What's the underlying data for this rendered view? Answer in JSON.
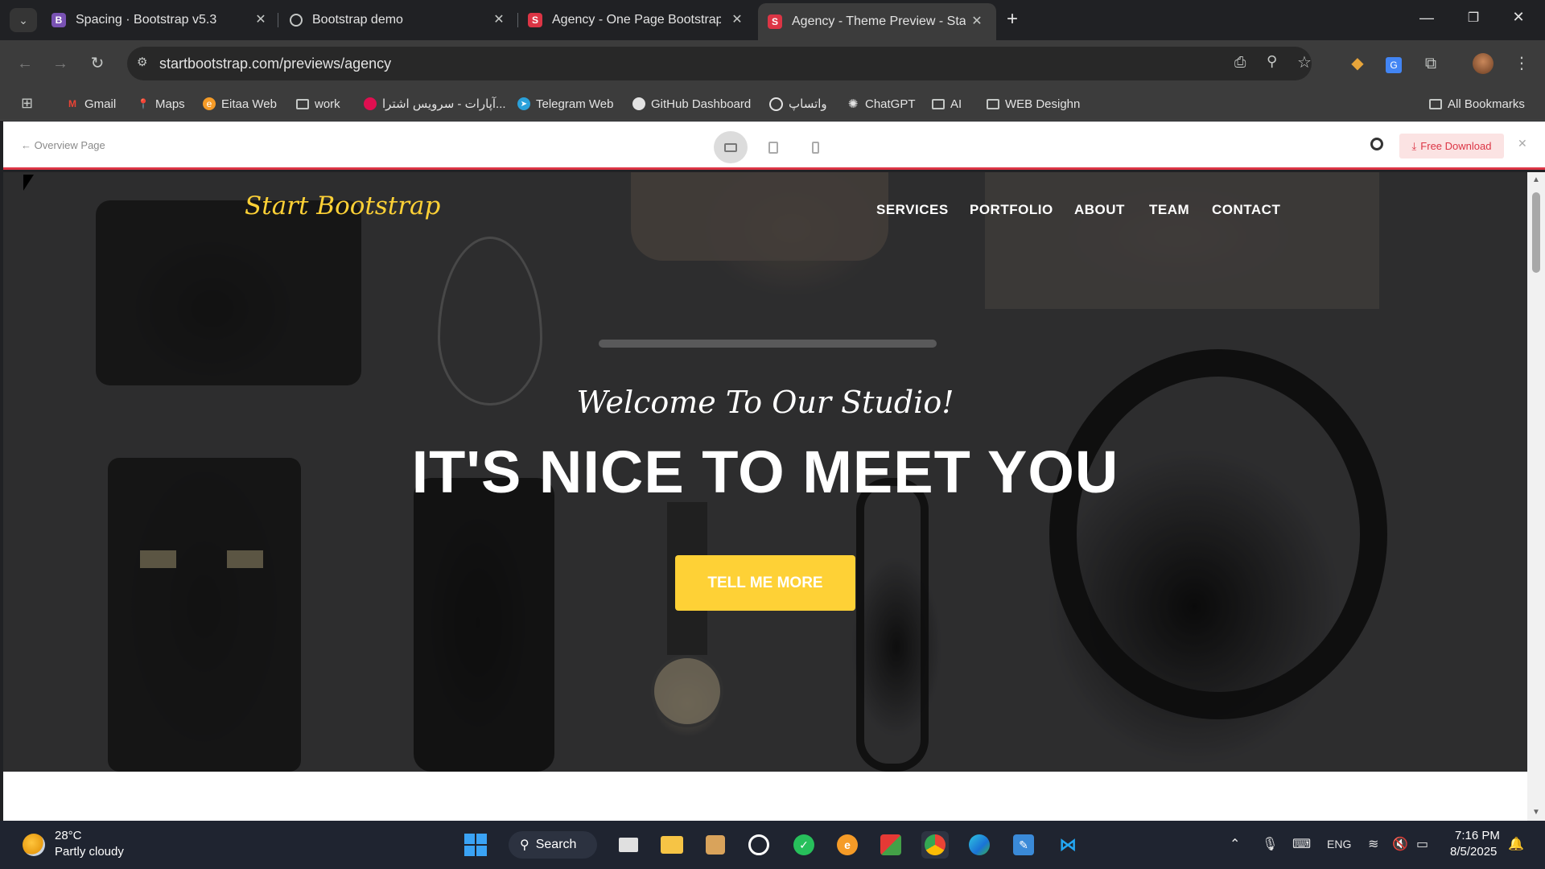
{
  "browser": {
    "tabs": [
      {
        "title": "Spacing · Bootstrap v5.3",
        "favicon": "B",
        "favicon_color": "#7952b3",
        "active": false
      },
      {
        "title": "Bootstrap demo",
        "favicon": "globe-icon",
        "active": false
      },
      {
        "title": "Agency - One Page Bootstrap T",
        "favicon": "S",
        "favicon_color": "#dc3545",
        "active": false
      },
      {
        "title": "Agency - Theme Preview - Star",
        "favicon": "S",
        "favicon_color": "#dc3545",
        "active": true
      }
    ],
    "url": "startbootstrap.com/previews/agency",
    "bookmarks": [
      {
        "label": "Gmail",
        "icon": "gmail-icon"
      },
      {
        "label": "Maps",
        "icon": "maps-icon"
      },
      {
        "label": "Eitaa Web",
        "icon": "eitaa-icon"
      },
      {
        "label": "work",
        "icon": "folder-icon"
      },
      {
        "label": "آپارات - سرویس اشترا...",
        "icon": "aparat-icon"
      },
      {
        "label": "Telegram Web",
        "icon": "telegram-icon"
      },
      {
        "label": "GitHub Dashboard",
        "icon": "github-icon"
      },
      {
        "label": "واتساپ",
        "icon": "whatsapp-icon"
      },
      {
        "label": "ChatGPT",
        "icon": "chatgpt-icon"
      },
      {
        "label": "AI",
        "icon": "folder-icon"
      },
      {
        "label": "WEB Desighn",
        "icon": "folder-icon"
      }
    ],
    "all_bookmarks": "All Bookmarks"
  },
  "preview": {
    "overview_link": "← Overview Page",
    "free_download": "Free Download",
    "accent": "#dc3545"
  },
  "site": {
    "brand": "Start Bootstrap",
    "nav": [
      "SERVICES",
      "PORTFOLIO",
      "ABOUT",
      "TEAM",
      "CONTACT"
    ],
    "subheading": "Welcome To Our Studio!",
    "heading": "IT'S NICE TO MEET YOU",
    "cta": "TELL ME MORE",
    "accent": "#fed136"
  },
  "taskbar": {
    "weather_temp": "28°C",
    "weather_desc": "Partly cloudy",
    "search": "Search",
    "language": "ENG",
    "time": "7:16 PM",
    "date": "8/5/2025"
  }
}
